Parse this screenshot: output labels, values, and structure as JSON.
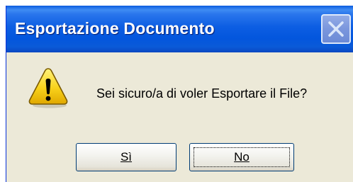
{
  "dialog": {
    "title": "Esportazione Documento",
    "message": "Sei sicuro/a di voler Esportare il File?",
    "icon": "warning-icon",
    "buttons": {
      "yes_label": "Sì",
      "no_label": "No"
    },
    "focused_button": "No"
  },
  "colors": {
    "titlebar": "#0356dd",
    "face": "#ece9d8",
    "warning_yellow": "#f8d21b",
    "button_border": "#003c74"
  }
}
